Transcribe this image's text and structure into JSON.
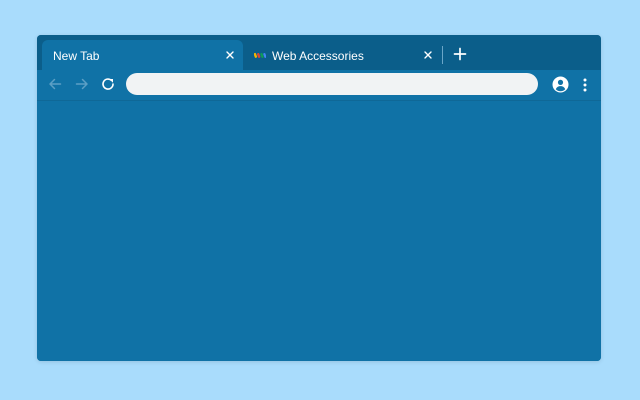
{
  "colors": {
    "background": "#a9dcfc",
    "frame": "#0b5e8a",
    "toolbar": "#1072a6",
    "omnibox": "#f1f3f4",
    "icon_active": "#ffffff",
    "icon_disabled": "#5c9fc5"
  },
  "tabs": [
    {
      "title": "New Tab",
      "active": true,
      "close_icon": "close-icon"
    },
    {
      "title": "Web Accessories",
      "active": false,
      "favicon": "web-accessories-favicon",
      "close_icon": "close-icon"
    }
  ],
  "tabstrip": {
    "new_tab_icon": "plus-icon"
  },
  "toolbar": {
    "back_icon": "arrow-left-icon",
    "forward_icon": "arrow-right-icon",
    "reload_icon": "reload-icon",
    "omnibox_value": "",
    "avatar_icon": "account-circle-icon",
    "menu_icon": "more-vertical-icon"
  }
}
